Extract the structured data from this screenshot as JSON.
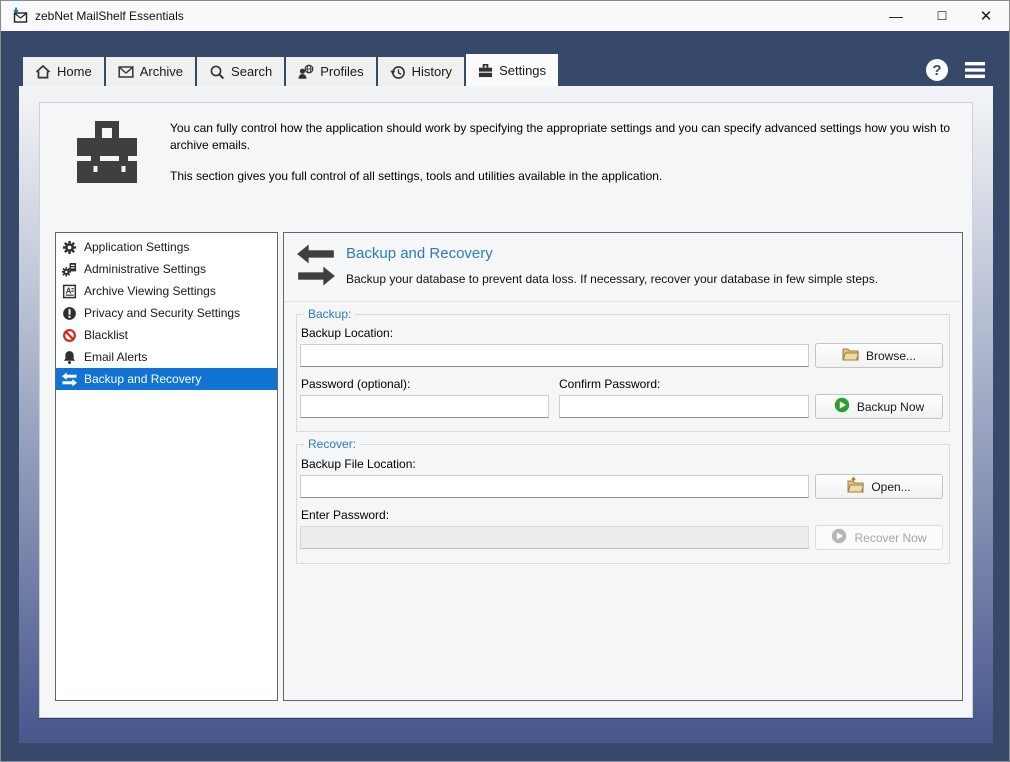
{
  "window": {
    "title": "zebNet MailShelf Essentials",
    "controls": {
      "minimize": "—",
      "maximize": "☐",
      "close": "✕"
    }
  },
  "tabs": {
    "items": [
      {
        "label": "Home",
        "icon": "home-icon"
      },
      {
        "label": "Archive",
        "icon": "envelope-icon"
      },
      {
        "label": "Search",
        "icon": "magnifier-icon"
      },
      {
        "label": "Profiles",
        "icon": "profiles-globe-icon"
      },
      {
        "label": "History",
        "icon": "history-clock-icon"
      },
      {
        "label": "Settings",
        "icon": "toolbox-icon"
      }
    ],
    "active": "Settings"
  },
  "header": {
    "paragraph1": "You can fully control how the application should work by specifying the appropriate settings and you can specify advanced settings how you wish to archive emails.",
    "paragraph2": "This section gives you full control of all settings, tools and utilities available in the application."
  },
  "sidebar": {
    "items": [
      {
        "label": "Application Settings",
        "icon": "gear-icon"
      },
      {
        "label": "Administrative Settings",
        "icon": "gear-server-icon"
      },
      {
        "label": "Archive Viewing Settings",
        "icon": "document-a-icon"
      },
      {
        "label": "Privacy and Security Settings",
        "icon": "exclamation-circle-icon"
      },
      {
        "label": "Blacklist",
        "icon": "prohibition-icon"
      },
      {
        "label": "Email Alerts",
        "icon": "bell-icon"
      },
      {
        "label": "Backup and Recovery",
        "icon": "swap-arrows-icon"
      }
    ],
    "selected": "Backup and Recovery"
  },
  "panel": {
    "title": "Backup and Recovery",
    "subtitle": "Backup your database to prevent data loss. If necessary, recover your database in few simple steps.",
    "backup_group": {
      "legend": "Backup:",
      "backup_location_label": "Backup Location:",
      "backup_location_value": "",
      "browse_button": "Browse...",
      "password_label": "Password (optional):",
      "password_value": "",
      "confirm_label": "Confirm Password:",
      "confirm_value": "",
      "backup_now_button": "Backup Now"
    },
    "recover_group": {
      "legend": "Recover:",
      "file_location_label": "Backup File Location:",
      "file_location_value": "",
      "open_button": "Open...",
      "enter_password_label": "Enter Password:",
      "enter_password_value": "",
      "recover_now_button": "Recover Now"
    }
  },
  "colors": {
    "navy_frame": "#37496B",
    "selection_blue": "#1174D4",
    "heading_blue": "#2B7BC0",
    "blacklist_red": "#D22D22",
    "backup_green": "#2F9E2F",
    "folder_tan": "#E3C083"
  }
}
